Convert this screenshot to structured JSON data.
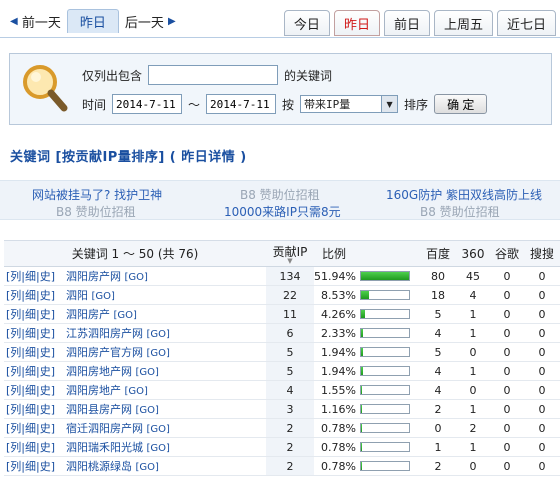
{
  "nav": {
    "prev_day": "前一天",
    "yesterday": "昨日",
    "next_day": "后一天",
    "tabs": [
      {
        "label": "今日",
        "active": false
      },
      {
        "label": "昨日",
        "active": true
      },
      {
        "label": "前日",
        "active": false
      },
      {
        "label": "上周五",
        "active": false
      },
      {
        "label": "近七日",
        "active": false
      }
    ]
  },
  "filter": {
    "only_contains": "仅列出包含",
    "keyword_input": "",
    "keyword_suffix": "的关键词",
    "time_label": "时间",
    "date_from": "2014-7-11",
    "range_sep": "～",
    "date_to": "2014-7-11",
    "by_label": "按",
    "sort_by": "带来IP量",
    "order_label": "排序",
    "ok": "确 定"
  },
  "heading": "关键词 [按贡献IP量排序] ( 昨日详情 )",
  "ads": {
    "a1": "网站被挂马了? 找护卫神",
    "a2": "B8 赞助位招租",
    "a3": "160G防护 紫田双线高防上线",
    "a4": "B8 赞助位招租",
    "a5": "10000来路IP只需8元",
    "a6": "B8 赞助位招租"
  },
  "table": {
    "headers": {
      "keyword": "关键词 1 ～ 50 (共 76)",
      "contrib": "贡献IP",
      "ratio": "比例",
      "baidu": "百度",
      "s360": "360",
      "google": "谷歌",
      "sogou": "搜搜"
    },
    "link_text": "[列|细|史]",
    "go_text": "[GO]",
    "rows": [
      {
        "kw": "泗阳房产网",
        "ip": "134",
        "ratio": "51.94%",
        "pct": 100,
        "baidu": "80",
        "s360": "45",
        "google": "0",
        "sogou": "0"
      },
      {
        "kw": "泗阳",
        "ip": "22",
        "ratio": "8.53%",
        "pct": 16,
        "baidu": "18",
        "s360": "4",
        "google": "0",
        "sogou": "0"
      },
      {
        "kw": "泗阳房产",
        "ip": "11",
        "ratio": "4.26%",
        "pct": 8,
        "baidu": "5",
        "s360": "1",
        "google": "0",
        "sogou": "0"
      },
      {
        "kw": "江苏泗阳房产网",
        "ip": "6",
        "ratio": "2.33%",
        "pct": 5,
        "baidu": "4",
        "s360": "1",
        "google": "0",
        "sogou": "0"
      },
      {
        "kw": "泗阳房产官方网",
        "ip": "5",
        "ratio": "1.94%",
        "pct": 4,
        "baidu": "5",
        "s360": "0",
        "google": "0",
        "sogou": "0"
      },
      {
        "kw": "泗阳房地产网",
        "ip": "5",
        "ratio": "1.94%",
        "pct": 4,
        "baidu": "4",
        "s360": "1",
        "google": "0",
        "sogou": "0"
      },
      {
        "kw": "泗阳房地产",
        "ip": "4",
        "ratio": "1.55%",
        "pct": 3,
        "baidu": "4",
        "s360": "0",
        "google": "0",
        "sogou": "0"
      },
      {
        "kw": "泗阳县房产网",
        "ip": "3",
        "ratio": "1.16%",
        "pct": 2,
        "baidu": "2",
        "s360": "1",
        "google": "0",
        "sogou": "0"
      },
      {
        "kw": "宿迁泗阳房产网",
        "ip": "2",
        "ratio": "0.78%",
        "pct": 2,
        "baidu": "0",
        "s360": "2",
        "google": "0",
        "sogou": "0"
      },
      {
        "kw": "泗阳瑞禾阳光城",
        "ip": "2",
        "ratio": "0.78%",
        "pct": 2,
        "baidu": "1",
        "s360": "1",
        "google": "0",
        "sogou": "0"
      },
      {
        "kw": "泗阳桃源绿岛",
        "ip": "2",
        "ratio": "0.78%",
        "pct": 2,
        "baidu": "2",
        "s360": "0",
        "google": "0",
        "sogou": "0"
      }
    ]
  }
}
